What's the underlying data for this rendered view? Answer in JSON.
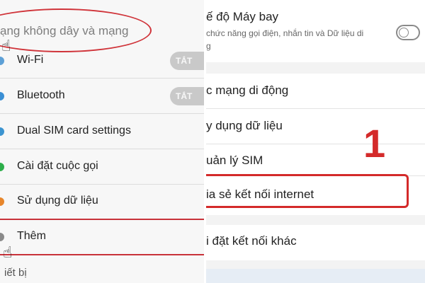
{
  "left": {
    "section_header": "ạng không dây và mạng",
    "toggle_label": "TẮT",
    "items": [
      {
        "label": "Wi-Fi",
        "dot_color": "#5da0d6"
      },
      {
        "label": "Bluetooth",
        "dot_color": "#3a8fd4"
      },
      {
        "label": "Dual SIM card settings",
        "dot_color": "#3c94d0"
      },
      {
        "label": "Cài đặt cuộc gọi",
        "dot_color": "#2dae4a"
      },
      {
        "label": "Sử dụng dữ liệu",
        "dot_color": "#e7862c"
      },
      {
        "label": "Thêm",
        "dot_color": "#8a8a8a"
      }
    ],
    "footer": "iết bị"
  },
  "right": {
    "airplane_title": "ế độ Máy bay",
    "airplane_sub1": "chức năng gọi điện, nhắn tin và Dữ liệu di",
    "airplane_sub2": "g",
    "items": [
      "c mạng di động",
      "y dụng dữ liệu",
      "uản lý SIM",
      "ia sẻ kết nối internet",
      "i đặt kết nối khác"
    ],
    "annotation_number": "1"
  },
  "colors": {
    "accent_red": "#d42a2a"
  }
}
